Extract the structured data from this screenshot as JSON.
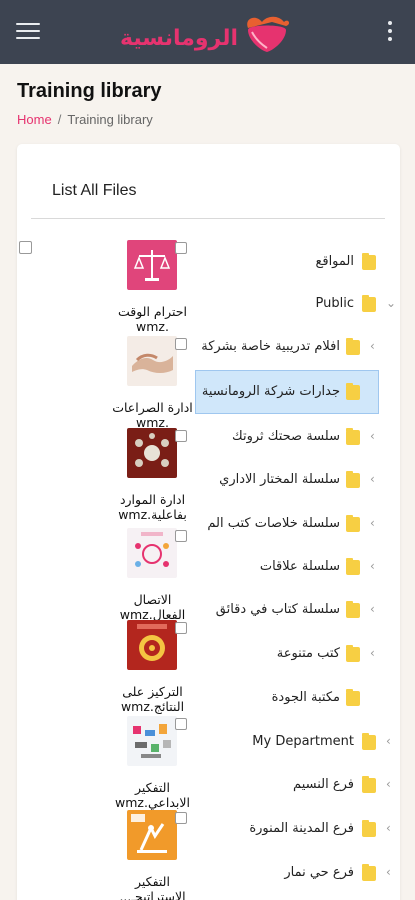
{
  "header": {
    "brand_name": "الرومانسية",
    "background_color": "#3d4451",
    "brand_color": "#e6336f"
  },
  "page": {
    "title": "Training library",
    "breadcrumb": {
      "home": "Home",
      "separator": "/",
      "current": "Training library"
    }
  },
  "card": {
    "title": "List All Files"
  },
  "files": [
    {
      "name": "احترام الوقت .wmz",
      "thumb_icon": "scales-icon",
      "thumb_color": "#e0457b"
    },
    {
      "name": "ادارة الصراعات .wmz",
      "thumb_icon": "handshake-icon",
      "thumb_color": "#ead7c8"
    },
    {
      "name": "ادارة الموارد بفاعلية.wmz",
      "thumb_icon": "resources-icon",
      "thumb_color": "#7a1e16"
    },
    {
      "name": "الاتصال الفعال.wmz",
      "thumb_icon": "communication-icon",
      "thumb_color": "#f3eef2"
    },
    {
      "name": "التركيز على النتائج.wmz",
      "thumb_icon": "target-icon",
      "thumb_color": "#b3261e"
    },
    {
      "name": "التفكير الابداعي.wmz",
      "thumb_icon": "creative-icon",
      "thumb_color": "#eef1f5"
    },
    {
      "name": "التفكير الاستراتيجـ...",
      "thumb_icon": "strategy-icon",
      "thumb_color": "#f19a2a"
    }
  ],
  "folders": [
    {
      "label": "المواقع",
      "expanded": false,
      "has_chevron": false,
      "level": 0
    },
    {
      "label": "Public",
      "expanded": true,
      "has_chevron": true,
      "level": 0
    },
    {
      "label": "افلام تدريبية خاصة بشركة",
      "has_chevron": true,
      "level": 1
    },
    {
      "label": "جدارات شركة الرومانسية",
      "has_chevron": false,
      "level": 1,
      "selected": true
    },
    {
      "label": "سلسة صحتك ثروتك",
      "has_chevron": true,
      "level": 1
    },
    {
      "label": "سلسلة المختار الاداري",
      "has_chevron": true,
      "level": 1
    },
    {
      "label": "سلسلة خلاصات كتب الم",
      "has_chevron": true,
      "level": 1
    },
    {
      "label": "سلسلة علاقات",
      "has_chevron": true,
      "level": 1
    },
    {
      "label": "سلسلة كتاب في دقائق",
      "has_chevron": true,
      "level": 1
    },
    {
      "label": "كتب متنوعة",
      "has_chevron": true,
      "level": 1
    },
    {
      "label": "مكتبة الجودة",
      "has_chevron": false,
      "level": 1
    },
    {
      "label": "My Department",
      "has_chevron": true,
      "level": 0
    },
    {
      "label": "فرع النسيم",
      "has_chevron": true,
      "level": 0
    },
    {
      "label": "فرع المدينة المنورة",
      "has_chevron": true,
      "level": 0
    },
    {
      "label": "فرع حي نمار",
      "has_chevron": true,
      "level": 0
    }
  ]
}
